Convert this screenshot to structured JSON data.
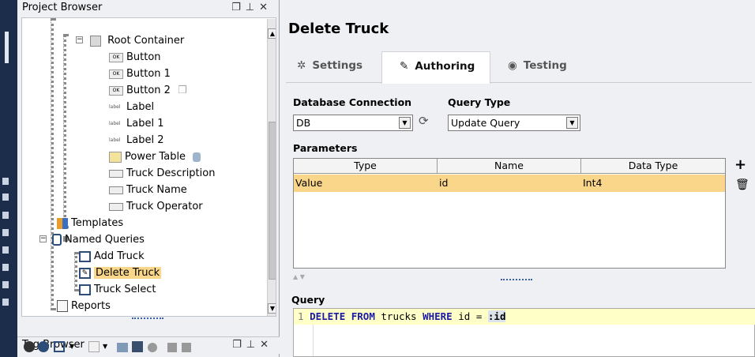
{
  "project_browser": {
    "title": "Project Browser",
    "tree": [
      {
        "label": "Root Container",
        "icon": "container-icon"
      },
      {
        "label": "Button",
        "icon": "button-icon"
      },
      {
        "label": "Button 1",
        "icon": "button-icon"
      },
      {
        "label": "Button 2",
        "icon": "button-icon"
      },
      {
        "label": "Label",
        "icon": "label-icon"
      },
      {
        "label": "Label 1",
        "icon": "label-icon"
      },
      {
        "label": "Label 2",
        "icon": "label-icon"
      },
      {
        "label": "Power Table",
        "icon": "table-icon"
      },
      {
        "label": "Truck Description",
        "icon": "textfield-icon"
      },
      {
        "label": "Truck Name",
        "icon": "textfield-icon"
      },
      {
        "label": "Truck Operator",
        "icon": "textfield-icon"
      },
      {
        "label": "Templates",
        "icon": "templates-icon"
      },
      {
        "label": "Named Queries",
        "icon": "database-icon"
      },
      {
        "label": "Add Truck",
        "icon": "query-icon"
      },
      {
        "label": "Delete Truck",
        "icon": "update-query-icon",
        "selected": true
      },
      {
        "label": "Truck Select",
        "icon": "query-icon"
      },
      {
        "label": "Reports",
        "icon": "report-icon"
      }
    ]
  },
  "tag_browser": {
    "title": "Tag Browser"
  },
  "editor": {
    "title": "Delete Truck",
    "tabs": [
      {
        "label": "Settings",
        "icon": "gear-icon"
      },
      {
        "label": "Authoring",
        "icon": "pencil-icon",
        "active": true
      },
      {
        "label": "Testing",
        "icon": "eye-icon"
      }
    ],
    "database_connection_label": "Database Connection",
    "database_connection_value": "DB",
    "query_type_label": "Query Type",
    "query_type_value": "Update Query",
    "parameters_label": "Parameters",
    "param_columns": [
      "Type",
      "Name",
      "Data Type"
    ],
    "param_rows": [
      {
        "type": "Value",
        "name": "id",
        "data_type": "Int4"
      }
    ],
    "query_label": "Query",
    "query_line_number": "1",
    "query_tokens": {
      "kw1": "DELETE",
      "kw2": "FROM",
      "t1": "trucks",
      "kw3": "WHERE",
      "t2": "id =",
      "param": ":id"
    },
    "colors": {
      "selection": "#f9d68a",
      "query_highlight": "#ffffc8",
      "keyword": "#1a1aa6"
    }
  }
}
